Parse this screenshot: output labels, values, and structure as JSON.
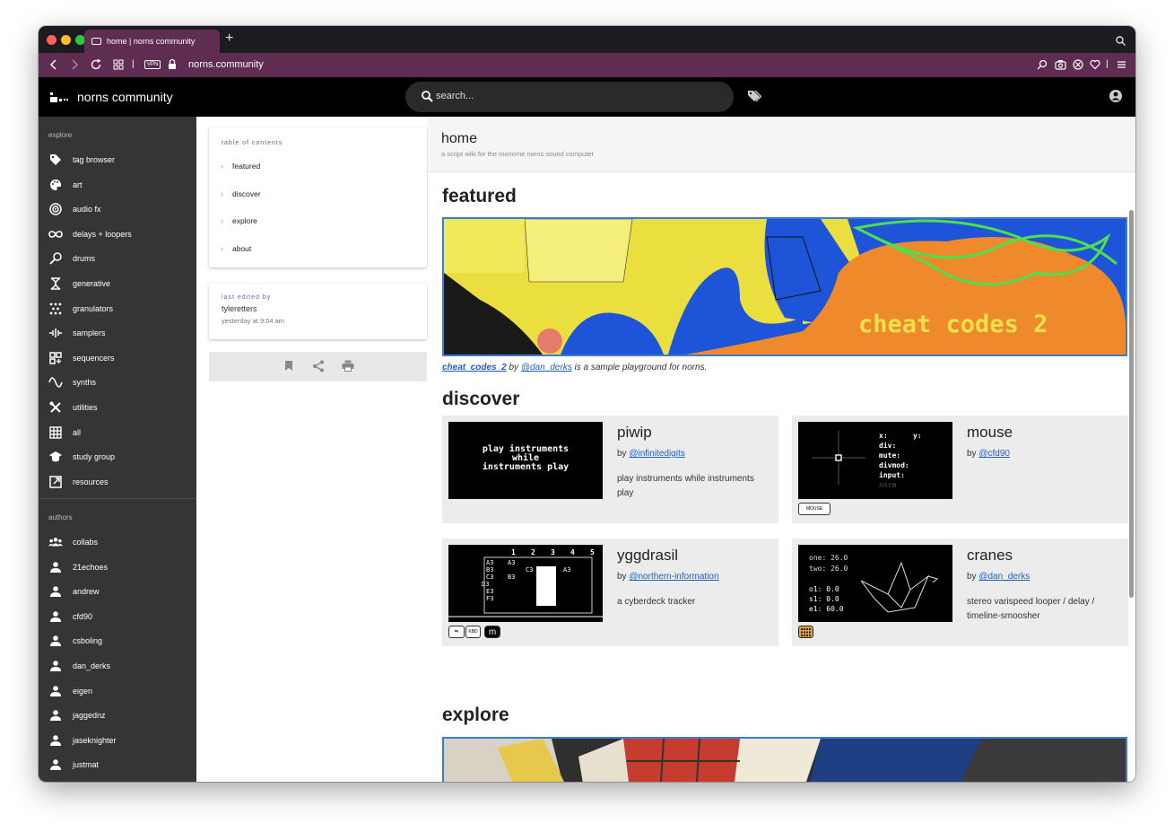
{
  "browser": {
    "tab_title": "home | norns community",
    "url": "norns.community",
    "vpn_label": "VPN"
  },
  "site": {
    "title": "norns community",
    "search_placeholder": "search..."
  },
  "sidebar": {
    "explore_heading": "explore",
    "explore_items": [
      {
        "label": "tag browser",
        "icon": "tag-icon"
      },
      {
        "label": "art",
        "icon": "palette-icon"
      },
      {
        "label": "audio fx",
        "icon": "target-icon"
      },
      {
        "label": "delays + loopers",
        "icon": "infinity-icon"
      },
      {
        "label": "drums",
        "icon": "drumstick-icon"
      },
      {
        "label": "generative",
        "icon": "dna-icon"
      },
      {
        "label": "granulators",
        "icon": "dots-grid-icon"
      },
      {
        "label": "samplers",
        "icon": "waveform-icon"
      },
      {
        "label": "sequencers",
        "icon": "sequencer-icon"
      },
      {
        "label": "synths",
        "icon": "sine-wave-icon"
      },
      {
        "label": "utilities",
        "icon": "tools-icon"
      },
      {
        "label": "all",
        "icon": "grid-icon"
      },
      {
        "label": "study group",
        "icon": "graduation-cap-icon"
      },
      {
        "label": "resources",
        "icon": "external-link-icon"
      }
    ],
    "authors_heading": "authors",
    "author_items": [
      {
        "label": "collabs",
        "icon": "group-icon"
      },
      {
        "label": "21echoes",
        "icon": "person-icon"
      },
      {
        "label": "andrew",
        "icon": "person-icon"
      },
      {
        "label": "cfd90",
        "icon": "person-icon"
      },
      {
        "label": "csboling",
        "icon": "person-icon"
      },
      {
        "label": "dan_derks",
        "icon": "person-icon"
      },
      {
        "label": "eigen",
        "icon": "person-icon"
      },
      {
        "label": "jaggednz",
        "icon": "person-icon"
      },
      {
        "label": "jaseknighter",
        "icon": "person-icon"
      },
      {
        "label": "justmat",
        "icon": "person-icon"
      }
    ]
  },
  "toc": {
    "title": "table of contents",
    "items": [
      "featured",
      "discover",
      "explore",
      "about"
    ]
  },
  "edited": {
    "label": "last edited by",
    "user": "tyleretters",
    "time": "yesterday at 9:04 am"
  },
  "page": {
    "title": "home",
    "subtitle": "a script wiki for the monome norns sound computer",
    "featured_heading": "featured",
    "featured_banner_text": "cheat codes 2",
    "featured_script": "cheat_codes_2",
    "featured_by": "by",
    "featured_author": "@dan_derks",
    "featured_tail": "is a sample playground for norns.",
    "discover_heading": "discover",
    "explore_heading": "explore"
  },
  "cards": [
    {
      "title": "piwip",
      "by": "by",
      "author": "@infinitedigits",
      "desc": "play instruments while instruments play",
      "thumb_lines": [
        "play instruments",
        "while",
        "instruments play"
      ],
      "badges": []
    },
    {
      "title": "mouse",
      "by": "by",
      "author": "@cfd90",
      "desc": "",
      "thumb_lines": [
        "x:",
        "y:",
        "div:",
        "mute:",
        "divmod:",
        "input:",
        "norm"
      ],
      "badges": [
        "MOUSE"
      ]
    },
    {
      "title": "yggdrasil",
      "by": "by",
      "author": "@northern-information",
      "desc": "a cyberdeck tracker",
      "thumb_lines": [
        "1",
        "2",
        "3",
        "4",
        "5",
        "A3",
        "A3",
        "B3",
        "C3",
        "A3",
        "C3",
        "B3",
        "D3",
        "E3",
        "F3"
      ],
      "badges": [
        "KBD",
        "m"
      ]
    },
    {
      "title": "cranes",
      "by": "by",
      "author": "@dan_derks",
      "desc": "stereo varispeed looper / delay / timeline-smoosher",
      "thumb_lines": [
        "one: 26.0",
        "two: 26.0",
        "o1: 0.0",
        "s1: 0.0",
        "e1: 60.0"
      ],
      "badges": [
        "grid"
      ]
    }
  ],
  "colors": {
    "browser_accent": "#5f2d52",
    "sidebar_bg": "#353535",
    "link": "#1f5fbf",
    "banner_border": "#3d7ad0"
  }
}
